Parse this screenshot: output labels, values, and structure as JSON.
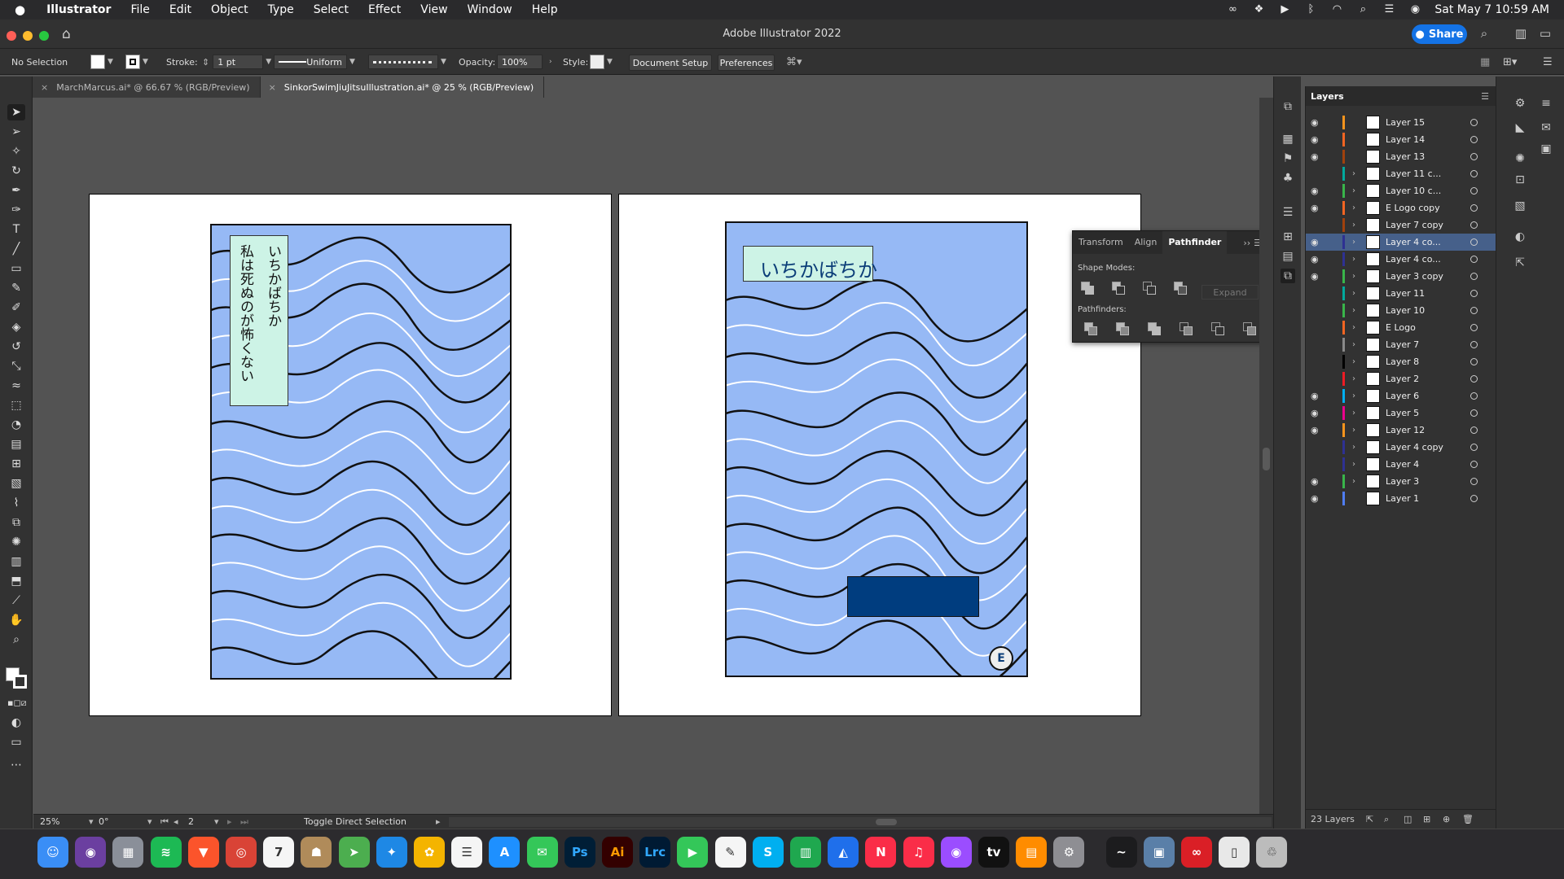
{
  "menubar": {
    "app_name": "Illustrator",
    "items": [
      "File",
      "Edit",
      "Object",
      "Type",
      "Select",
      "Effect",
      "View",
      "Window",
      "Help"
    ],
    "clock": "Sat May 7  10:59 AM"
  },
  "window": {
    "title": "Adobe Illustrator 2022",
    "share_label": "Share"
  },
  "controlbar": {
    "selection": "No Selection",
    "stroke_label": "Stroke:",
    "stroke_value": "1 pt",
    "profile_value": "Uniform",
    "opacity_label": "Opacity:",
    "opacity_value": "100%",
    "style_label": "Style:",
    "document_setup_label": "Document Setup",
    "preferences_label": "Preferences"
  },
  "tabs": [
    {
      "label": "MarchMarcus.ai* @ 66.67 % (RGB/Preview)",
      "active": false
    },
    {
      "label": "SinkorSwimJiuJitsuIllustration.ai* @ 25 % (RGB/Preview)",
      "active": true
    }
  ],
  "artwork": {
    "left_vertical_text_1": "私は死ぬのが怖くない",
    "left_vertical_text_2": "いちかばちか",
    "right_title": "いちかばちか",
    "cover_color": "#96b9f5",
    "label_color": "#cdf3e6",
    "navy_color": "#003d7f"
  },
  "pathfinder": {
    "tabs": [
      "Transform",
      "Align",
      "Pathfinder"
    ],
    "shape_modes_label": "Shape Modes:",
    "pathfinders_label": "Pathfinders:",
    "expand_label": "Expand"
  },
  "layers": {
    "title": "Layers",
    "count_label": "23 Layers",
    "items": [
      {
        "name": "Layer 15",
        "visible": true,
        "color": "#f7941d",
        "expandable": false,
        "selected": false
      },
      {
        "name": "Layer 14",
        "visible": true,
        "color": "#f26522",
        "expandable": false,
        "selected": false
      },
      {
        "name": "Layer 13",
        "visible": true,
        "color": "#a0410d",
        "expandable": false,
        "selected": false
      },
      {
        "name": "Layer 11 c...",
        "visible": false,
        "color": "#00a99d",
        "expandable": true,
        "selected": false
      },
      {
        "name": "Layer 10 c...",
        "visible": true,
        "color": "#39b54a",
        "expandable": true,
        "selected": false
      },
      {
        "name": "E Logo copy",
        "visible": true,
        "color": "#f26522",
        "expandable": true,
        "selected": false
      },
      {
        "name": "Layer 7 copy",
        "visible": false,
        "color": "#a0410d",
        "expandable": true,
        "selected": false
      },
      {
        "name": "Layer 4 co...",
        "visible": true,
        "color": "#2e3192",
        "expandable": true,
        "selected": true
      },
      {
        "name": "Layer 4 co...",
        "visible": true,
        "color": "#2e3192",
        "expandable": true,
        "selected": false
      },
      {
        "name": "Layer 3 copy",
        "visible": true,
        "color": "#39b54a",
        "expandable": true,
        "selected": false
      },
      {
        "name": "Layer 11",
        "visible": false,
        "color": "#00a99d",
        "expandable": true,
        "selected": false
      },
      {
        "name": "Layer 10",
        "visible": false,
        "color": "#39b54a",
        "expandable": true,
        "selected": false
      },
      {
        "name": "E Logo",
        "visible": false,
        "color": "#f26522",
        "expandable": true,
        "selected": false
      },
      {
        "name": "Layer 7",
        "visible": false,
        "color": "#898989",
        "expandable": true,
        "selected": false
      },
      {
        "name": "Layer 8",
        "visible": false,
        "color": "#000000",
        "expandable": true,
        "selected": false
      },
      {
        "name": "Layer 2",
        "visible": false,
        "color": "#ed1c24",
        "expandable": true,
        "selected": false
      },
      {
        "name": "Layer 6",
        "visible": true,
        "color": "#00aeef",
        "expandable": true,
        "selected": false
      },
      {
        "name": "Layer 5",
        "visible": true,
        "color": "#ec008c",
        "expandable": true,
        "selected": false
      },
      {
        "name": "Layer 12",
        "visible": true,
        "color": "#f7941d",
        "expandable": true,
        "selected": false
      },
      {
        "name": "Layer 4 copy",
        "visible": false,
        "color": "#2e3192",
        "expandable": true,
        "selected": false
      },
      {
        "name": "Layer 4",
        "visible": false,
        "color": "#2e3192",
        "expandable": true,
        "selected": false
      },
      {
        "name": "Layer 3",
        "visible": true,
        "color": "#39b54a",
        "expandable": true,
        "selected": false
      },
      {
        "name": "Layer 1",
        "visible": true,
        "color": "#4f7df2",
        "expandable": false,
        "selected": false
      }
    ]
  },
  "statusbar": {
    "zoom": "25%",
    "rotation": "0°",
    "artboard": "2",
    "hint": "Toggle Direct Selection"
  },
  "dock": [
    {
      "name": "finder-icon",
      "color": "#3a8ef6",
      "glyph": "☺"
    },
    {
      "name": "siri-icon",
      "color": "#6b3fa0",
      "glyph": "◉"
    },
    {
      "name": "launchpad-icon",
      "color": "#8a8f99",
      "glyph": "▦"
    },
    {
      "name": "spotify-icon",
      "color": "#1db954",
      "glyph": "≋"
    },
    {
      "name": "brave-icon",
      "color": "#fb542b",
      "glyph": "▼"
    },
    {
      "name": "chrome-icon",
      "color": "#d94336",
      "glyph": "◎"
    },
    {
      "name": "calendar-icon",
      "color": "#f5f5f5",
      "glyph": "7"
    },
    {
      "name": "contacts-icon",
      "color": "#b08b5a",
      "glyph": "☗"
    },
    {
      "name": "maps-icon",
      "color": "#4cae4f",
      "glyph": "➤"
    },
    {
      "name": "safari-icon",
      "color": "#1e88e5",
      "glyph": "✦"
    },
    {
      "name": "photos-icon",
      "color": "#f4b400",
      "glyph": "✿"
    },
    {
      "name": "reminders-icon",
      "color": "#f5f5f5",
      "glyph": "☰"
    },
    {
      "name": "appstore-icon",
      "color": "#1e90ff",
      "glyph": "A"
    },
    {
      "name": "messages-icon",
      "color": "#34c759",
      "glyph": "✉"
    },
    {
      "name": "photoshop-icon",
      "color": "#001e36",
      "glyph": "Ps"
    },
    {
      "name": "illustrator-icon",
      "color": "#330000",
      "glyph": "Ai"
    },
    {
      "name": "lightroom-icon",
      "color": "#001a33",
      "glyph": "Lrc"
    },
    {
      "name": "facetime-icon",
      "color": "#34c759",
      "glyph": "▶"
    },
    {
      "name": "textedit-icon",
      "color": "#f5f5f5",
      "glyph": "✎"
    },
    {
      "name": "skype-icon",
      "color": "#00aff0",
      "glyph": "S"
    },
    {
      "name": "numbers-icon",
      "color": "#1fa84f",
      "glyph": "▥"
    },
    {
      "name": "keynote-icon",
      "color": "#1f6feb",
      "glyph": "◭"
    },
    {
      "name": "news-icon",
      "color": "#fa2d48",
      "glyph": "N"
    },
    {
      "name": "music-icon",
      "color": "#fa2d48",
      "glyph": "♫"
    },
    {
      "name": "podcasts-icon",
      "color": "#9b4dff",
      "glyph": "◉"
    },
    {
      "name": "appletv-icon",
      "color": "#111111",
      "glyph": "tv"
    },
    {
      "name": "books-icon",
      "color": "#ff8c00",
      "glyph": "▤"
    },
    {
      "name": "system-preferences-icon",
      "color": "#8e8e93",
      "glyph": "⚙"
    },
    {
      "name": "activity-monitor-icon",
      "color": "#1c1c1e",
      "glyph": "~"
    },
    {
      "name": "preview-icon",
      "color": "#5a7fa8",
      "glyph": "▣"
    },
    {
      "name": "creative-cloud-icon",
      "color": "#da1f26",
      "glyph": "∞"
    },
    {
      "name": "documents-folder-icon",
      "color": "#e8e8e8",
      "glyph": "▯"
    },
    {
      "name": "trash-icon",
      "color": "#bcbcbc",
      "glyph": "♲"
    }
  ]
}
